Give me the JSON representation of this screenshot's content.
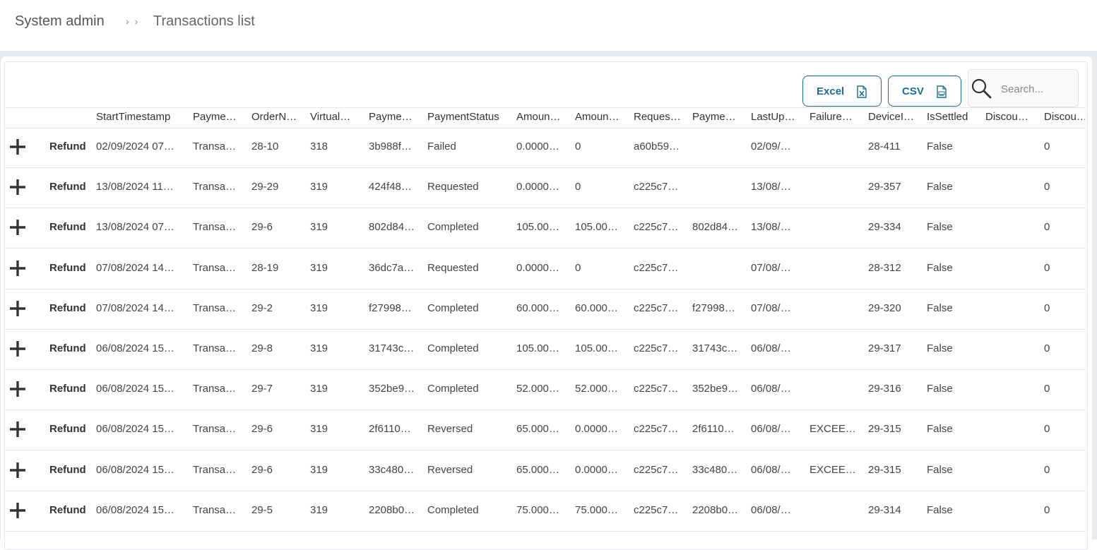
{
  "breadcrumb": {
    "root": "System admin",
    "separator": "› ›",
    "current": "Transactions list"
  },
  "toolbar": {
    "excel_label": "Excel",
    "csv_label": "CSV",
    "excel_icon": "excel-file-icon",
    "csv_icon": "csv-file-icon"
  },
  "search": {
    "placeholder": "Search...",
    "value": "",
    "icon": "search-icon"
  },
  "colors": {
    "accent": "#1b6c96",
    "page_bg": "#e6e9ee"
  },
  "table": {
    "action_label": "Refund",
    "columns": [
      "StartTimestamp",
      "Payme…",
      "OrderN…",
      "Virtual…",
      "Payme…",
      "PaymentStatus",
      "Amoun…",
      "Amoun…",
      "Reques…",
      "Payme…",
      "LastUp…",
      "Failure…",
      "DeviceI…",
      "IsSettled",
      "Discou…",
      "Discou…"
    ],
    "rows": [
      [
        "02/09/2024 07…",
        "Transa…",
        "28-10",
        "318",
        "3b988f…",
        "Failed",
        "0.0000…",
        "0",
        "a60b59…",
        "",
        "02/09/…",
        "",
        "28-411",
        "False",
        "",
        "0"
      ],
      [
        "13/08/2024 11…",
        "Transa…",
        "29-29",
        "319",
        "424f48…",
        "Requested",
        "0.0000…",
        "0",
        "c225c7…",
        "",
        "13/08/…",
        "",
        "29-357",
        "False",
        "",
        "0"
      ],
      [
        "13/08/2024 07…",
        "Transa…",
        "29-6",
        "319",
        "802d84…",
        "Completed",
        "105.00…",
        "105.00…",
        "c225c7…",
        "802d84…",
        "13/08/…",
        "",
        "29-334",
        "False",
        "",
        "0"
      ],
      [
        "07/08/2024 14…",
        "Transa…",
        "28-19",
        "319",
        "36dc7a…",
        "Requested",
        "0.0000…",
        "0",
        "c225c7…",
        "",
        "07/08/…",
        "",
        "28-312",
        "False",
        "",
        "0"
      ],
      [
        "07/08/2024 14…",
        "Transa…",
        "29-2",
        "319",
        "f27998…",
        "Completed",
        "60.000…",
        "60.000…",
        "c225c7…",
        "f27998…",
        "07/08/…",
        "",
        "29-320",
        "False",
        "",
        "0"
      ],
      [
        "06/08/2024 15…",
        "Transa…",
        "29-8",
        "319",
        "31743c…",
        "Completed",
        "105.00…",
        "105.00…",
        "c225c7…",
        "31743c…",
        "06/08/…",
        "",
        "29-317",
        "False",
        "",
        "0"
      ],
      [
        "06/08/2024 15…",
        "Transa…",
        "29-7",
        "319",
        "352be9…",
        "Completed",
        "52.000…",
        "52.000…",
        "c225c7…",
        "352be9…",
        "06/08/…",
        "",
        "29-316",
        "False",
        "",
        "0"
      ],
      [
        "06/08/2024 15…",
        "Transa…",
        "29-6",
        "319",
        "2f6110…",
        "Reversed",
        "65.000…",
        "0.0000…",
        "c225c7…",
        "2f6110…",
        "06/08/…",
        "EXCEE…",
        "29-315",
        "False",
        "",
        "0"
      ],
      [
        "06/08/2024 15…",
        "Transa…",
        "29-6",
        "319",
        "33c480…",
        "Reversed",
        "65.000…",
        "0.0000…",
        "c225c7…",
        "33c480…",
        "06/08/…",
        "EXCEE…",
        "29-315",
        "False",
        "",
        "0"
      ],
      [
        "06/08/2024 15…",
        "Transa…",
        "29-5",
        "319",
        "2208b0…",
        "Completed",
        "75.000…",
        "75.000…",
        "c225c7…",
        "2208b0…",
        "06/08/…",
        "",
        "29-314",
        "False",
        "",
        "0"
      ]
    ]
  }
}
